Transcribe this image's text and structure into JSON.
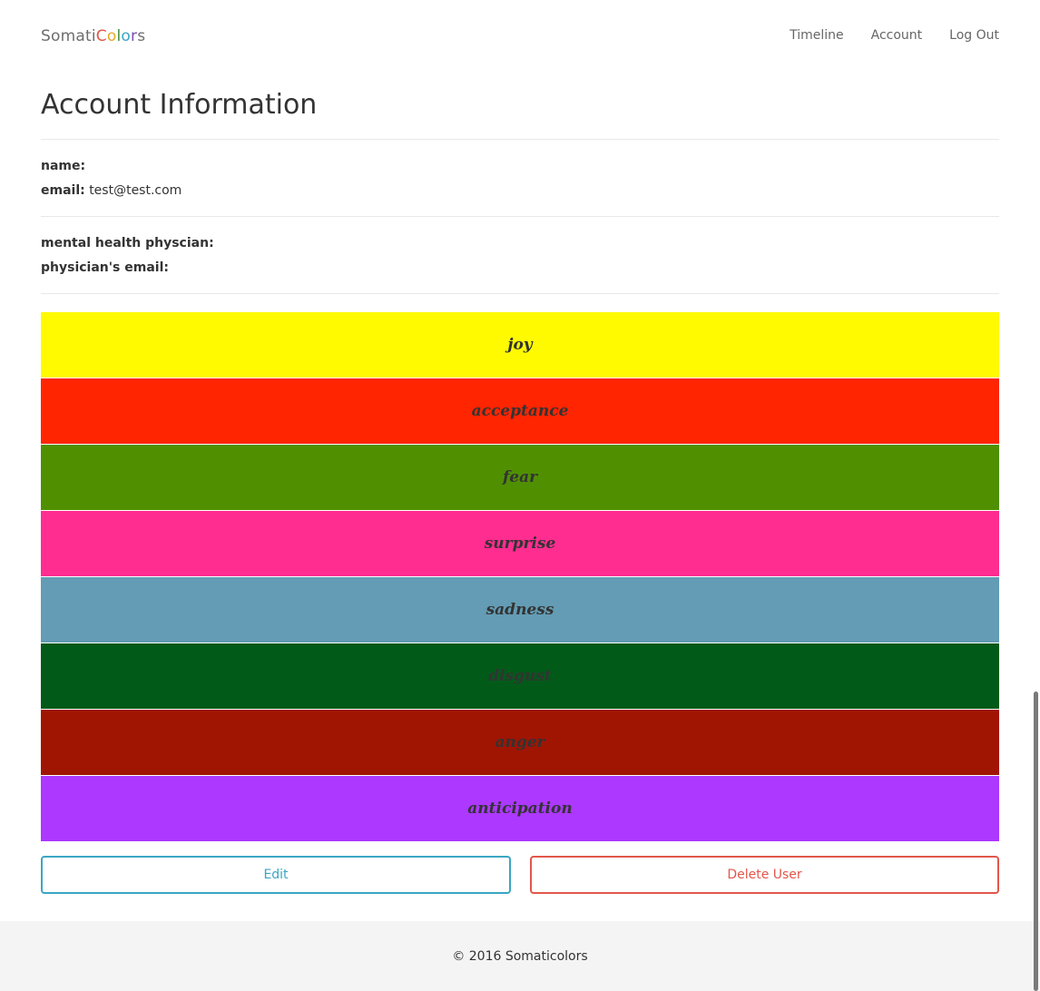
{
  "brand": {
    "parts": [
      {
        "text": "Somati",
        "color": "#6d6d6d"
      },
      {
        "text": "C",
        "color": "#e2564a"
      },
      {
        "text": "o",
        "color": "#e0a92a"
      },
      {
        "text": "l",
        "color": "#3f8f3f"
      },
      {
        "text": "o",
        "color": "#3aa6c3"
      },
      {
        "text": "r",
        "color": "#7a4fb0"
      },
      {
        "text": "s",
        "color": "#6d6d6d"
      }
    ]
  },
  "nav": {
    "timeline": "Timeline",
    "account": "Account",
    "logout": "Log Out"
  },
  "page": {
    "title": "Account Information"
  },
  "account": {
    "name_label": "name:",
    "name_value": "",
    "email_label": "email:",
    "email_value": "test@test.com"
  },
  "physician": {
    "name_label": "mental health physcian:",
    "name_value": "",
    "email_label": "physician's email:",
    "email_value": ""
  },
  "emotions": [
    {
      "label": "joy",
      "color": "#fffa00"
    },
    {
      "label": "acceptance",
      "color": "#ff2500"
    },
    {
      "label": "fear",
      "color": "#509000"
    },
    {
      "label": "surprise",
      "color": "#ff2d90"
    },
    {
      "label": "sadness",
      "color": "#639cb4"
    },
    {
      "label": "disgust",
      "color": "#025a19"
    },
    {
      "label": "anger",
      "color": "#a01502"
    },
    {
      "label": "anticipation",
      "color": "#ad38ff"
    }
  ],
  "actions": {
    "edit": "Edit",
    "delete": "Delete User"
  },
  "footer": {
    "text": "© 2016 Somaticolors"
  }
}
